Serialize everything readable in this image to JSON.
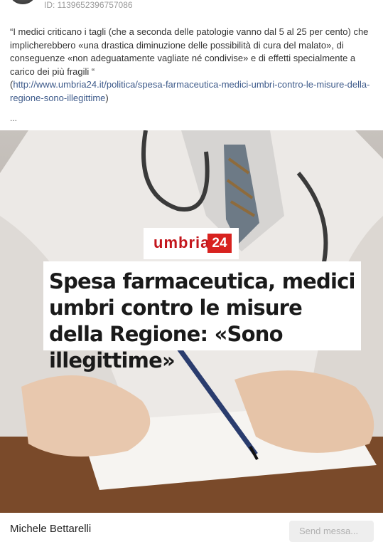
{
  "post": {
    "id_label": "ID: 1139652396757086",
    "text": "“I medici criticano i tagli (che a seconda delle patologie vanno dal 5 al 25 per cento) che implicherebbero «una drastica diminuzione delle possibilità di cura del malato», di conseguenze «non adeguatamente vagliate né condivise» e di effetti specialmente a carico dei più fragili “",
    "link_open": "(",
    "link": "http://www.umbria24.it/politica/spesa-farmaceutica-medici-umbri-contro-le-misure-della-regione-sono-illegittime",
    "link_close": ")",
    "more": "..."
  },
  "media": {
    "logo_word": "umbria",
    "logo_number": "24",
    "headline": "Spesa farmaceutica, medici umbri contro le misure della Regione: «Sono illegittime»",
    "colors": {
      "brand_red": "#d8221f",
      "coat": "#f2f0ee",
      "desk": "#7a4a2a"
    }
  },
  "footer": {
    "author": "Michele Bettarelli",
    "send_placeholder": "Send messa..."
  }
}
